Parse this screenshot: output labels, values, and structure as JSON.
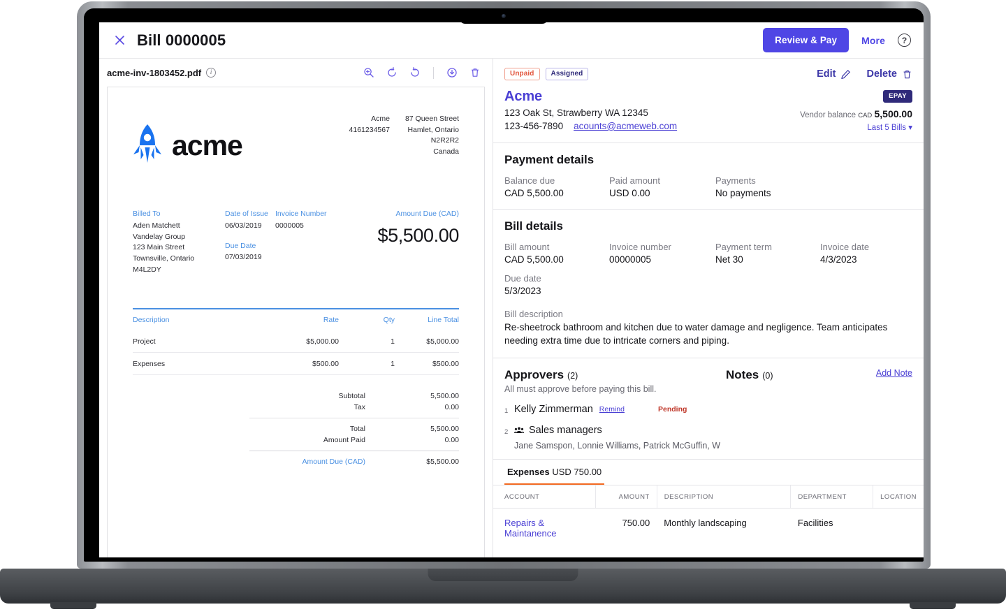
{
  "topbar": {
    "close_icon": "close-x-icon",
    "title": "Bill 0000005",
    "review_pay": "Review & Pay",
    "more": "More",
    "help": "?"
  },
  "pdf_toolbar": {
    "filename": "acme-inv-1803452.pdf",
    "info": "i",
    "tools": [
      "zoom-in-icon",
      "rotate-left-icon",
      "rotate-right-icon",
      "download-icon",
      "delete-icon"
    ]
  },
  "invoice": {
    "logo_text": "acme",
    "from": {
      "col1": [
        "Acme",
        "4161234567"
      ],
      "col2": [
        "87 Queen Street",
        "Hamlet, Ontario",
        "N2R2R2",
        "Canada"
      ]
    },
    "billed_to_label": "Billed To",
    "billed_to": [
      "Aden Matchett",
      "Vandelay Group",
      "123 Main Street",
      "Townsville, Ontario",
      "M4L2DY"
    ],
    "date_of_issue_label": "Date of Issue",
    "date_of_issue": "06/03/2019",
    "due_date_label": "Due Date",
    "due_date": "07/03/2019",
    "invoice_number_label": "Invoice Number",
    "invoice_number": "0000005",
    "amount_due_label": "Amount Due (CAD)",
    "amount_due": "$5,500.00",
    "table_headers": [
      "Description",
      "Rate",
      "Qty",
      "Line Total"
    ],
    "line_items": [
      {
        "description": "Project",
        "rate": "$5,000.00",
        "qty": "1",
        "total": "$5,000.00"
      },
      {
        "description": "Expenses",
        "rate": "$500.00",
        "qty": "1",
        "total": "$500.00"
      }
    ],
    "totals": [
      {
        "label": "Subtotal",
        "value": "5,500.00"
      },
      {
        "label": "Tax",
        "value": "0.00"
      },
      {
        "label": "Total",
        "value": "5,500.00"
      },
      {
        "label": "Amount Paid",
        "value": "0.00"
      },
      {
        "label": "Amount Due (CAD)",
        "value": "$5,500.00"
      }
    ]
  },
  "details": {
    "chips": {
      "unpaid": "Unpaid",
      "assigned": "Assigned"
    },
    "actions": {
      "edit": "Edit",
      "delete": "Delete"
    },
    "vendor": {
      "name": "Acme",
      "address": "123 Oak St, Strawberry WA 12345",
      "phone": "123-456-7890",
      "email": "acounts@acmeweb.com",
      "epay_badge": "EPAY",
      "balance_label": "Vendor balance",
      "balance_currency": "CAD",
      "balance_value": "5,500.00",
      "last_bills": "Last 5 Bills"
    },
    "payment": {
      "title": "Payment details",
      "fields": [
        {
          "label": "Balance due",
          "value": "CAD 5,500.00"
        },
        {
          "label": "Paid amount",
          "value": "USD 0.00"
        },
        {
          "label": "Payments",
          "value": "No payments"
        }
      ]
    },
    "bill": {
      "title": "Bill details",
      "fields": [
        {
          "label": "Bill amount",
          "value": "CAD 5,500.00"
        },
        {
          "label": "Invoice number",
          "value": "00000005"
        },
        {
          "label": "Payment term",
          "value": "Net 30"
        },
        {
          "label": "Invoice date",
          "value": "4/3/2023"
        }
      ],
      "due_date_label": "Due date",
      "due_date_value": "5/3/2023",
      "description_label": "Bill description",
      "description_value": "Re-sheetrock bathroom and kitchen due to water damage and negligence. Team anticipates needing extra time due to intricate corners and piping."
    },
    "approvers": {
      "title": "Approvers",
      "count": "(2)",
      "subtitle": "All must approve before paying this bill.",
      "items": [
        {
          "num": "1",
          "name": "Kelly Zimmerman",
          "remind": "Remind",
          "status": "Pending"
        },
        {
          "num": "2",
          "name": "Sales managers",
          "members": "Jane Samspon, Lonnie Williams, Patrick McGuffin, We"
        }
      ]
    },
    "notes": {
      "title": "Notes",
      "count": "(0)",
      "add_note": "Add Note"
    },
    "expenses": {
      "tab_label": "Expenses",
      "tab_amount": "USD 750.00",
      "headers": [
        "ACCOUNT",
        "AMOUNT",
        "DESCRIPTION",
        "DEPARTMENT",
        "LOCATION"
      ],
      "rows": [
        {
          "account": "Repairs & Maintanence",
          "amount": "750.00",
          "description": "Monthly landscaping",
          "department": "Facilities",
          "location": ""
        }
      ]
    }
  },
  "colors": {
    "accent": "#4f46e5",
    "vendor_link": "#4a3fd4",
    "unpaid": "#e2553c",
    "pending": "#c0392b",
    "tab_underline": "#f26a21",
    "pdf_blue": "#4a90e2",
    "rocket_blue": "#1a73ef"
  }
}
